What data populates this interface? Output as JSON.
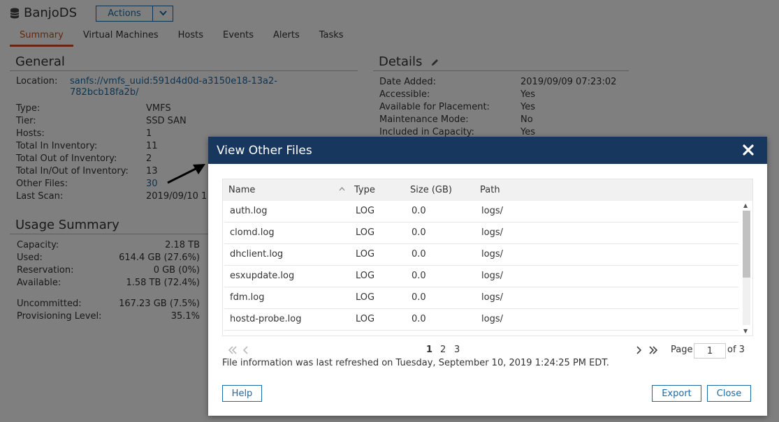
{
  "app": {
    "title": "BanjoDS",
    "actions_label": "Actions"
  },
  "tabs": [
    {
      "label": "Summary",
      "active": true
    },
    {
      "label": "Virtual Machines"
    },
    {
      "label": "Hosts"
    },
    {
      "label": "Events"
    },
    {
      "label": "Alerts"
    },
    {
      "label": "Tasks"
    }
  ],
  "general": {
    "title": "General",
    "location_label": "Location:",
    "location_line1": "sanfs://vmfs_uuid:591d4d0d-a3150e18-13a2-",
    "location_line2": "782bcb18fa2b/",
    "rows": [
      {
        "label": "Type:",
        "value": "VMFS"
      },
      {
        "label": "Tier:",
        "value": "SSD SAN"
      },
      {
        "label": "Hosts:",
        "value": "1"
      },
      {
        "label": "Total In Inventory:",
        "value": "11"
      },
      {
        "label": "Total Out of Inventory:",
        "value": "2"
      },
      {
        "label": "Total In/Out of Inventory:",
        "value": "13"
      },
      {
        "label": "Other Files:",
        "value": "30"
      },
      {
        "label": "Last Scan:",
        "value": "2019/09/10 1"
      }
    ]
  },
  "details": {
    "title": "Details",
    "rows": [
      {
        "label": "Date Added:",
        "value": "2019/09/09 07:23:02"
      },
      {
        "label": "Accessible:",
        "value": "Yes"
      },
      {
        "label": "Available for Placement:",
        "value": "Yes"
      },
      {
        "label": "Maintenance Mode:",
        "value": "No"
      },
      {
        "label": "Included in Capacity:",
        "value": "Yes"
      }
    ]
  },
  "usage": {
    "title": "Usage Summary",
    "rows": [
      {
        "label": "Capacity:",
        "value": "2.18 TB"
      },
      {
        "label": "Used:",
        "value": "614.4 GB (27.6%)"
      },
      {
        "label": "Reservation:",
        "value": "0 GB (0%)"
      },
      {
        "label": "Available:",
        "value": "1.58 TB (72.4%)"
      },
      {
        "label": "Uncommitted:",
        "value": "167.23 GB (7.5%)"
      },
      {
        "label": "Provisioning Level:",
        "value": "35.1%"
      }
    ]
  },
  "modal": {
    "title": "View Other Files",
    "columns": [
      "Name",
      "Type",
      "Size (GB)",
      "Path"
    ],
    "rows": [
      {
        "name": "auth.log",
        "type": "LOG",
        "size": "0.0",
        "path": "logs/"
      },
      {
        "name": "clomd.log",
        "type": "LOG",
        "size": "0.0",
        "path": "logs/"
      },
      {
        "name": "dhclient.log",
        "type": "LOG",
        "size": "0.0",
        "path": "logs/"
      },
      {
        "name": "esxupdate.log",
        "type": "LOG",
        "size": "0.0",
        "path": "logs/"
      },
      {
        "name": "fdm.log",
        "type": "LOG",
        "size": "0.0",
        "path": "logs/"
      },
      {
        "name": "hostd-probe.log",
        "type": "LOG",
        "size": "0.0",
        "path": "logs/"
      }
    ],
    "pages": [
      "1",
      "2",
      "3"
    ],
    "page_label": "Page",
    "page_value": "1",
    "page_of": "of 3",
    "refresh_text": "File information was last refreshed on Tuesday, September 10, 2019 1:24:25 PM EDT.",
    "help_label": "Help",
    "export_label": "Export",
    "close_label": "Close"
  }
}
